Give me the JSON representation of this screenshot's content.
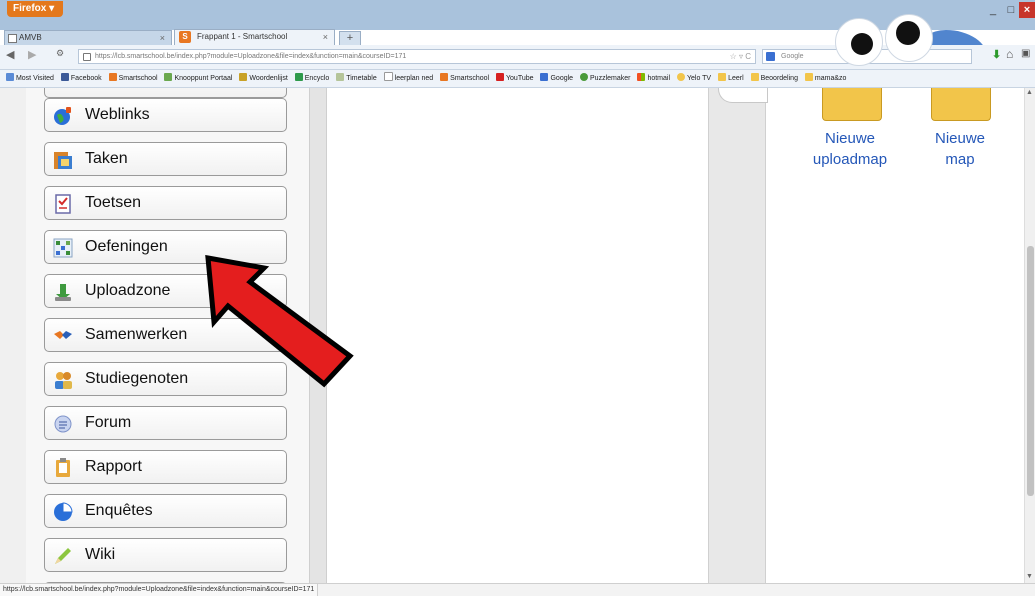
{
  "browser": {
    "app_button": "Firefox",
    "tabs": [
      {
        "label": "AMVB"
      },
      {
        "label": "Frappant 1 - Smartschool"
      }
    ],
    "url": "https://lcb.smartschool.be/index.php?module=Uploadzone&file=index&function=main&courseID=171",
    "search_placeholder": "Google",
    "bookmarks": [
      "Most Visited",
      "Facebook",
      "Smartschool",
      "Knooppunt Portaal",
      "Woordenlijst",
      "Encyclo",
      "Timetable",
      "leerplan ned",
      "Smartschool",
      "YouTube",
      "Google",
      "Puzzlemaker",
      "hotmail",
      "Yelo TV",
      "Leerl",
      "Beoordeling",
      "mama&zo"
    ],
    "status_url": "https://lcb.smartschool.be/index.php?module=Uploadzone&file=index&function=main&courseID=171"
  },
  "sidebar": {
    "items": [
      {
        "label": "Weblinks",
        "icon": "weblinks-icon"
      },
      {
        "label": "Taken",
        "icon": "tasks-icon"
      },
      {
        "label": "Toetsen",
        "icon": "tests-icon"
      },
      {
        "label": "Oefeningen",
        "icon": "exercises-icon"
      },
      {
        "label": "Uploadzone",
        "icon": "upload-icon"
      },
      {
        "label": "Samenwerken",
        "icon": "collaborate-icon"
      },
      {
        "label": "Studiegenoten",
        "icon": "classmates-icon"
      },
      {
        "label": "Forum",
        "icon": "forum-icon"
      },
      {
        "label": "Rapport",
        "icon": "report-icon"
      },
      {
        "label": "Enquêtes",
        "icon": "survey-icon"
      },
      {
        "label": "Wiki",
        "icon": "wiki-icon"
      }
    ]
  },
  "actions": {
    "new_upload_folder": {
      "line1": "Nieuwe",
      "line2": "uploadmap"
    },
    "new_folder": {
      "line1": "Nieuwe",
      "line2": "map"
    }
  },
  "annotation": {
    "arrow_color": "#e41e1e",
    "points_to": "Uploadzone"
  }
}
